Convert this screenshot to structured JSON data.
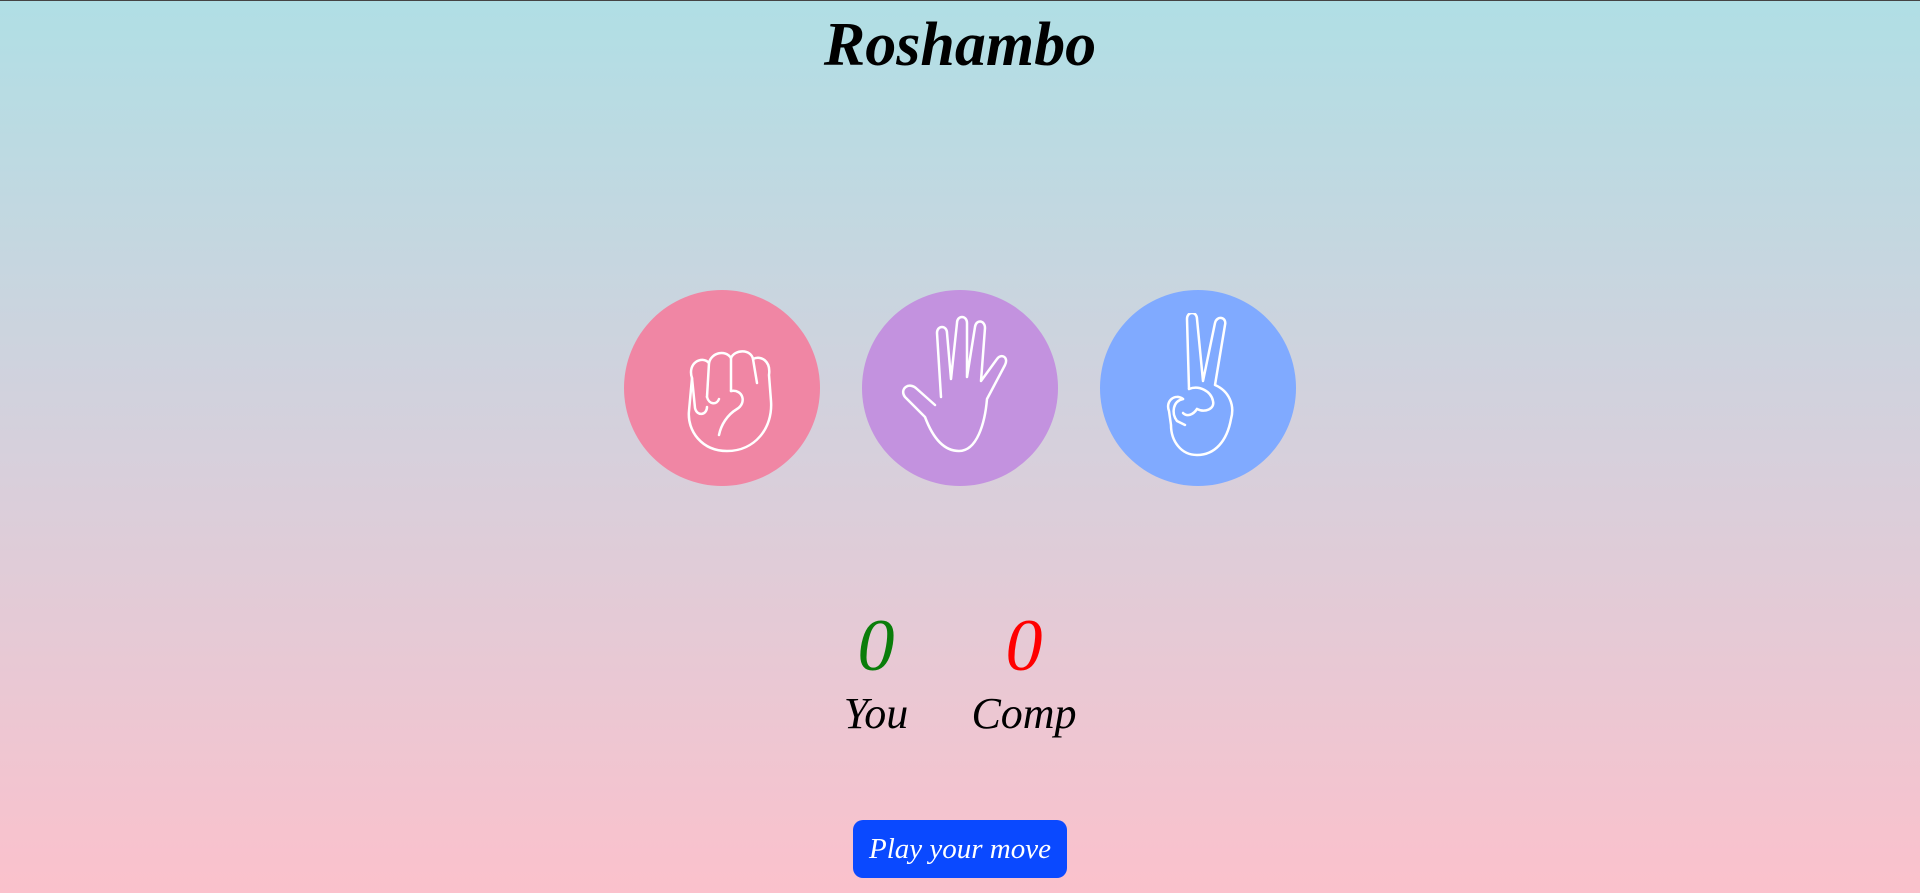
{
  "app": {
    "title": "Roshambo"
  },
  "choices": [
    {
      "name": "rock",
      "icon": "rock-fist-icon",
      "color": "#f086a4"
    },
    {
      "name": "paper",
      "icon": "paper-open-hand-icon",
      "color": "#c392df"
    },
    {
      "name": "scissors",
      "icon": "scissors-victory-hand-icon",
      "color": "#80aaff"
    }
  ],
  "score": {
    "you": {
      "value": "0",
      "label": "You",
      "color": "#0a7d0a"
    },
    "comp": {
      "value": "0",
      "label": "Comp",
      "color": "#ff0000"
    }
  },
  "actions": {
    "play_label": "Play your move",
    "play_color": "#0a49ff"
  }
}
